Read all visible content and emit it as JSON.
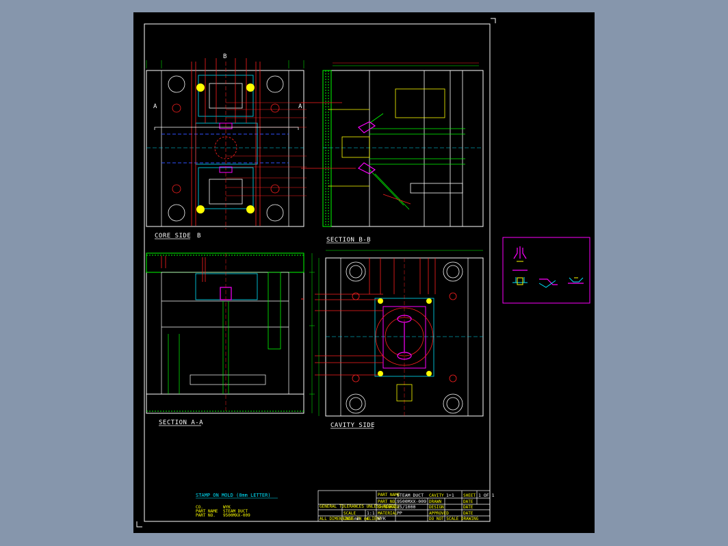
{
  "views": {
    "core_side": "CORE SIDE",
    "section_bb": "SECTION B-B",
    "section_aa": "SECTION A-A",
    "cavity_side": "CAVITY SIDE"
  },
  "section_markers": {
    "b": "B",
    "a": "A"
  },
  "stamp": {
    "heading": "STAMP ON MOLD (8mm LETTER)",
    "rows": [
      {
        "key": "CO.",
        "value": "WYK"
      },
      {
        "key": "PART NAME",
        "value": "STEAM DUCT"
      },
      {
        "key": "PART NO.",
        "value": "9500MXX-009"
      }
    ]
  },
  "title_block": {
    "part_name_label": "PART NAME",
    "part_name": "STEAM DUCT",
    "part_no_label": "PART NO.",
    "part_no": "9500MXX-009",
    "shrinkage_label": "SHRINKAGE",
    "shrinkage": "15/1000",
    "material_label": "MATERIAL",
    "material": "PP",
    "scale_label": "SCALE",
    "scale": "1:1",
    "client_label": "CLIENT",
    "client": "WYK",
    "sheet_label": "SHEET",
    "sheet": "1 OF 1",
    "drawn_label": "DRAWN",
    "design_label": "DESIGN",
    "approved_label": "APPROVED",
    "date_label": "DATE",
    "gen_tol_label": "GENERAL TOLERANCES UNLESS NOTED",
    "cavity_label": "CAVITY",
    "cavity": "1+1",
    "note": "DO NOT SCALE DRAWING",
    "all_dim_label": "ALL DIMENSIONS IN mm",
    "unit_label": "UNIT",
    "unit": "mm"
  },
  "colors": {
    "background": "#8696ac",
    "sheet": "#000000",
    "border": "#ffffff",
    "green": "#00ff00",
    "red": "#ff2020",
    "cyan": "#00e5ff",
    "yellow": "#ffff00",
    "magenta": "#ff00ff",
    "blue": "#3050ff"
  }
}
